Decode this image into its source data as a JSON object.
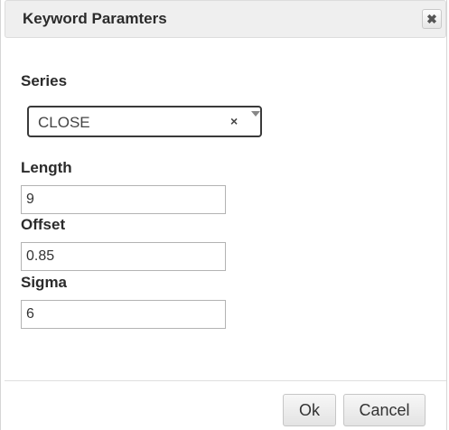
{
  "dialog": {
    "title": "Keyword Paramters",
    "close_icon_glyph": "✖"
  },
  "series": {
    "label": "Series",
    "selected": "CLOSE",
    "clear_glyph": "×"
  },
  "length": {
    "label": "Length",
    "value": "9"
  },
  "offset": {
    "label": "Offset",
    "value": "0.85"
  },
  "sigma": {
    "label": "Sigma",
    "value": "6"
  },
  "buttons": {
    "ok": "Ok",
    "cancel": "Cancel"
  }
}
